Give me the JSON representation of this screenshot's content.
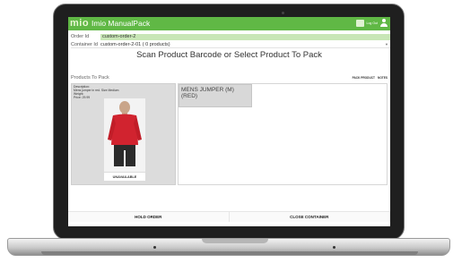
{
  "app": {
    "logo": "mio",
    "title": "Imio ManualPack",
    "toolbar_text_1": "",
    "toolbar_text_2": "Log Out"
  },
  "order": {
    "label": "Order Id",
    "value": "custom-order-2"
  },
  "container": {
    "label": "Container Id",
    "value": "custom-order-2-01 ( 0 products)"
  },
  "heading": "Scan Product Barcode or Select Product To Pack",
  "products": {
    "section_title": "Products To Pack",
    "pack_product_label": "PACK PRODUCT",
    "notes_label": "NOTES",
    "description_label": "Description:",
    "description_text": "Mens jumper in red. Size Medium",
    "weight_label": "Weight:",
    "price_label": "Price: 29.99",
    "status_label": "UNAVAILABLE"
  },
  "pack_area": {
    "items": [
      "MENS JUMPER (M) (RED)"
    ]
  },
  "footer": {
    "hold_order_label": "HOLD ORDER",
    "close_container_label": "CLOSE CONTAINER"
  },
  "colors": {
    "accent": "#60b845",
    "order_highlight": "#c8e6b6",
    "jumper": "#d1232f"
  },
  "icons": [
    "monitor-icon",
    "user-icon",
    "chevron-down-icon",
    "camera-icon"
  ]
}
